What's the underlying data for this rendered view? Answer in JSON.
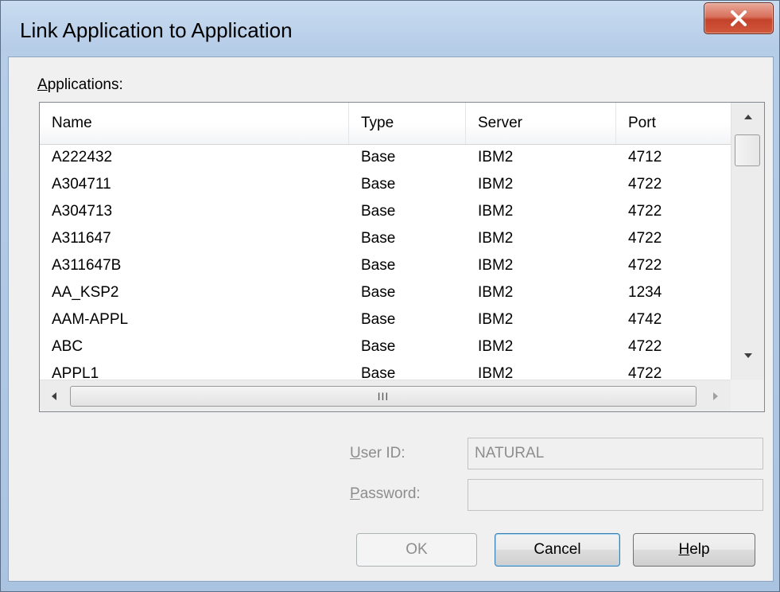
{
  "window": {
    "title": "Link Application to Application",
    "close_glyph": "X"
  },
  "applications_label": {
    "first_letter": "A",
    "rest": "pplications:"
  },
  "list": {
    "columns": [
      "Name",
      "Type",
      "Server",
      "Port"
    ],
    "rows": [
      {
        "name": "A222432",
        "type": "Base",
        "server": "IBM2",
        "port": "4712"
      },
      {
        "name": "A304711",
        "type": "Base",
        "server": "IBM2",
        "port": "4722"
      },
      {
        "name": "A304713",
        "type": "Base",
        "server": "IBM2",
        "port": "4722"
      },
      {
        "name": "A311647",
        "type": "Base",
        "server": "IBM2",
        "port": "4722"
      },
      {
        "name": "A311647B",
        "type": "Base",
        "server": "IBM2",
        "port": "4722"
      },
      {
        "name": "AA_KSP2",
        "type": "Base",
        "server": "IBM2",
        "port": "1234"
      },
      {
        "name": "AAM-APPL",
        "type": "Base",
        "server": "IBM2",
        "port": "4742"
      },
      {
        "name": "ABC",
        "type": "Base",
        "server": "IBM2",
        "port": "4722"
      },
      {
        "name": "APPL1",
        "type": "Base",
        "server": "IBM2",
        "port": "4722"
      }
    ],
    "hscroll_grip": "III"
  },
  "form": {
    "user_id_label_first": "U",
    "user_id_label_rest": "ser ID:",
    "user_id_value": "NATURAL",
    "password_label_first": "P",
    "password_label_rest": "assword:",
    "password_value": ""
  },
  "buttons": {
    "ok": "OK",
    "cancel": "Cancel",
    "help_first": "H",
    "help_rest": "elp"
  },
  "colors": {
    "close_button": "#c4422a",
    "disabled_text": "#8d8d8d",
    "default_button_border": "#3c7fb1"
  }
}
